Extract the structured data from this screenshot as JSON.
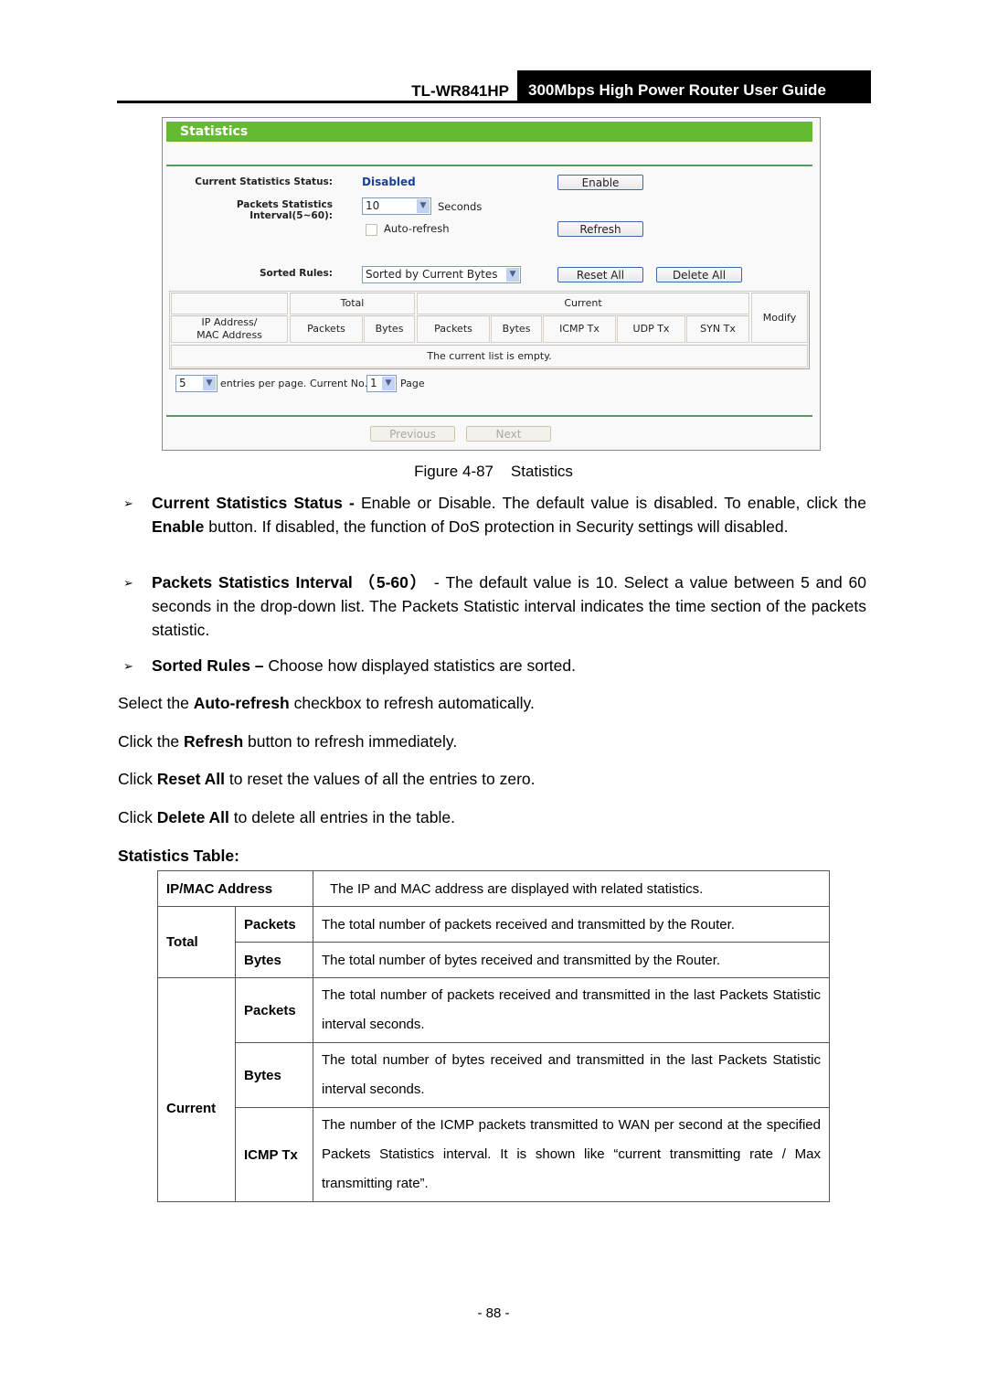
{
  "header": {
    "model": "TL-WR841HP",
    "guide_title": "300Mbps High Power Router User Guide"
  },
  "screenshot": {
    "title": "Statistics",
    "status_label": "Current Statistics Status:",
    "status_value": "Disabled",
    "enable_button": "Enable",
    "interval_label": "Packets Statistics Interval(5~60):",
    "interval_value": "10",
    "interval_unit": "Seconds",
    "auto_refresh_label": "Auto-refresh",
    "auto_refresh_checked": false,
    "refresh_button": "Refresh",
    "sorted_rules_label": "Sorted Rules:",
    "sorted_rules_value": "Sorted by Current Bytes",
    "reset_all_button": "Reset All",
    "delete_all_button": "Delete All",
    "table": {
      "group_total": "Total",
      "group_current": "Current",
      "col_ip_mac": "IP Address/ MAC Address",
      "col_total_packets": "Packets",
      "col_total_bytes": "Bytes",
      "col_cur_packets": "Packets",
      "col_cur_bytes": "Bytes",
      "col_icmp": "ICMP Tx",
      "col_udp": "UDP Tx",
      "col_syn": "SYN Tx",
      "col_modify": "Modify",
      "empty_message": "The current list is empty."
    },
    "entries_per_page_value": "5",
    "entries_per_page_label": "entries per page.",
    "current_no_label": "Current No.",
    "current_page_value": "1",
    "page_label": "Page",
    "previous_button": "Previous",
    "next_button": "Next"
  },
  "caption": "Figure 4-87    Statistics",
  "bullets": [
    {
      "term": "Current Statistics Status -",
      "text": " Enable or Disable. The default value is disabled. To enable, click the ",
      "term2": "Enable",
      "text2": " button. If disabled, the function of DoS protection in Security settings will disabled."
    },
    {
      "term": "Packets Statistics Interval （5-60）",
      "text": " - The default value is 10. Select a value between 5 and 60 seconds in the drop-down list. The Packets Statistic interval indicates the time section of the packets statistic."
    },
    {
      "term": "Sorted Rules –",
      "text": " Choose how displayed statistics are sorted."
    }
  ],
  "instructions": [
    {
      "pre": "Select the ",
      "bold": "Auto-refresh",
      "post": " checkbox to refresh automatically."
    },
    {
      "pre": "Click the ",
      "bold": "Refresh",
      "post": " button to refresh immediately."
    },
    {
      "pre": "Click ",
      "bold": "Reset All",
      "post": " to reset the values of all the entries to zero."
    },
    {
      "pre": "Click ",
      "bold": "Delete All",
      "post": " to delete all entries in the table."
    }
  ],
  "section_title": "Statistics Table:",
  "desc_table": {
    "ip_mac": {
      "label": "IP/MAC Address",
      "desc": "The IP and MAC address are displayed with related statistics."
    },
    "total": {
      "label": "Total",
      "packets": {
        "label": "Packets",
        "desc": "The total number of packets received and transmitted by the Router."
      },
      "bytes": {
        "label": "Bytes",
        "desc": "The total number of bytes received and transmitted by the Router."
      }
    },
    "current": {
      "label": "Current",
      "packets": {
        "label": "Packets",
        "desc": "The total number of packets received and transmitted in the last Packets Statistic interval seconds."
      },
      "bytes": {
        "label": "Bytes",
        "desc": "The total number of bytes received and transmitted in the last Packets Statistic interval seconds."
      },
      "icmp": {
        "label": "ICMP Tx",
        "desc": "The number of the ICMP packets transmitted to WAN per second at the specified Packets Statistics interval. It is shown like “current transmitting rate / Max transmitting rate”."
      }
    }
  },
  "page_number": "- 88 -"
}
